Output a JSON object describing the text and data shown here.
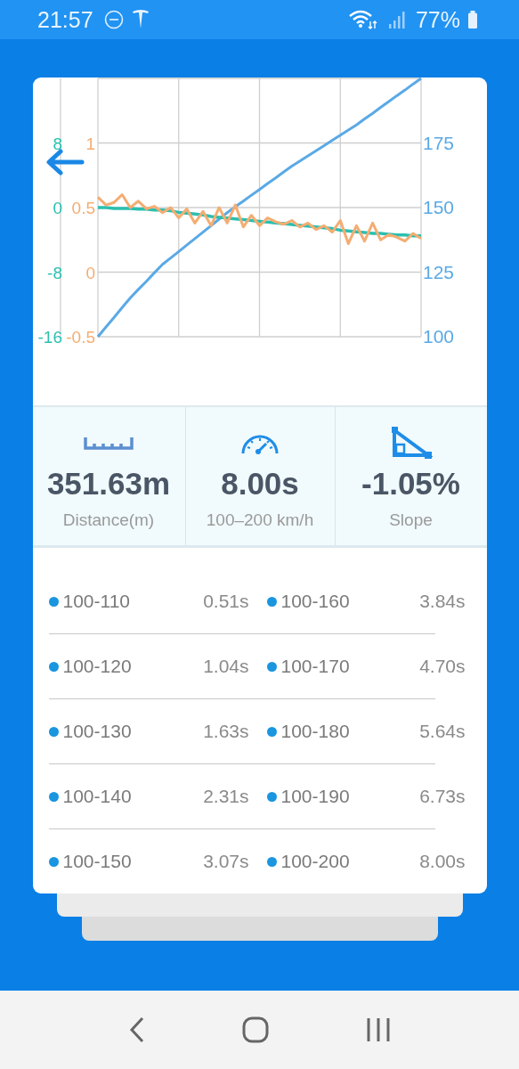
{
  "status_bar": {
    "time": "21:57",
    "battery": "77%"
  },
  "chart": {
    "chart_data": {
      "type": "line",
      "grid": true,
      "ylim": [
        100,
        200
      ],
      "yticks": [
        100,
        125,
        150,
        175
      ],
      "y2lim": [
        -16,
        16
      ],
      "y2ticks": [
        {
          "value": 8,
          "label": "8"
        },
        {
          "value": 0,
          "label": "0"
        },
        {
          "value": -8,
          "label": "-8"
        },
        {
          "value": -16,
          "label": "-16"
        }
      ],
      "y3lim": [
        -0.5,
        1.5
      ],
      "y3ticks": [
        {
          "value": 1,
          "label": "1"
        },
        {
          "value": 0.5,
          "label": "0.5"
        },
        {
          "value": 0,
          "label": "0"
        },
        {
          "value": -0.5,
          "label": "-0.5"
        }
      ],
      "series": [
        {
          "color": "#5aa9e6",
          "values": [
            100,
            103.8,
            107.5,
            111.3,
            115,
            118.3,
            121.5,
            124.8,
            128,
            130.5,
            133,
            135.5,
            138,
            140.5,
            143,
            145.5,
            148,
            150.3,
            152.5,
            154.8,
            157,
            159.3,
            161.5,
            163.8,
            166,
            168,
            170,
            172,
            174,
            176,
            178,
            180,
            182,
            184.3,
            186.5,
            188.8,
            191,
            193.3,
            195.5,
            197.8,
            200
          ]
        },
        {
          "color": "#2bbfb0",
          "axis": "y2",
          "values": [
            0,
            0,
            -0.1,
            -0.1,
            -0.1,
            -0.2,
            -0.2,
            -0.3,
            -0.3,
            -0.4,
            -0.6,
            -0.7,
            -0.8,
            -0.9,
            -1.1,
            -1.2,
            -1.3,
            -1.4,
            -1.5,
            -1.6,
            -1.7,
            -1.8,
            -1.9,
            -2.0,
            -2.1,
            -2.2,
            -2.3,
            -2.4,
            -2.5,
            -2.6,
            -2.8,
            -2.9,
            -3.0,
            -3.1,
            -3.2,
            -3.2,
            -3.3,
            -3.4,
            -3.4,
            -3.5,
            -3.5
          ]
        },
        {
          "color": "#f4ad72",
          "axis": "y3",
          "values": [
            0.58,
            0.52,
            0.54,
            0.6,
            0.5,
            0.55,
            0.49,
            0.51,
            0.46,
            0.5,
            0.42,
            0.49,
            0.38,
            0.47,
            0.36,
            0.5,
            0.38,
            0.52,
            0.35,
            0.44,
            0.36,
            0.42,
            0.39,
            0.37,
            0.4,
            0.35,
            0.38,
            0.33,
            0.36,
            0.31,
            0.4,
            0.22,
            0.36,
            0.24,
            0.38,
            0.25,
            0.29,
            0.27,
            0.24,
            0.3,
            0.26
          ]
        }
      ]
    }
  },
  "stats": [
    {
      "kind": "distance",
      "value": "351.63m",
      "label": "Distance(m)"
    },
    {
      "kind": "time",
      "value": "8.00s",
      "label": "100–200 km/h"
    },
    {
      "kind": "slope",
      "value": "-1.05%",
      "label": "Slope"
    }
  ],
  "splits": [
    {
      "range": "100-110",
      "time": "0.51s"
    },
    {
      "range": "100-160",
      "time": "3.84s"
    },
    {
      "range": "100-120",
      "time": "1.04s"
    },
    {
      "range": "100-170",
      "time": "4.70s"
    },
    {
      "range": "100-130",
      "time": "1.63s"
    },
    {
      "range": "100-180",
      "time": "5.64s"
    },
    {
      "range": "100-140",
      "time": "2.31s"
    },
    {
      "range": "100-190",
      "time": "6.73s"
    },
    {
      "range": "100-150",
      "time": "3.07s"
    },
    {
      "range": "100-200",
      "time": "8.00s"
    }
  ]
}
